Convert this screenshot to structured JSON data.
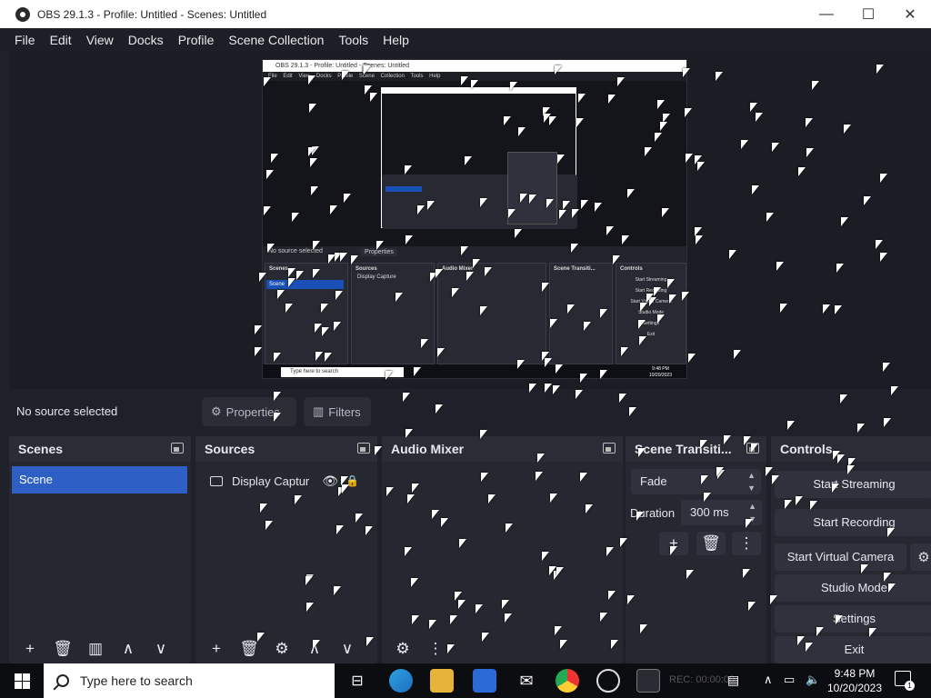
{
  "window": {
    "title": "OBS 29.1.3 - Profile: Untitled - Scenes: Untitled",
    "min": "—",
    "max": "☐",
    "close": "✕"
  },
  "menu": [
    "File",
    "Edit",
    "View",
    "Docks",
    "Profile",
    "Scene Collection",
    "Tools",
    "Help"
  ],
  "preview": {
    "title": "OBS 29.1.3 - Profile: Untitled - Scenes: Untitled",
    "menu": "File Edit View Docks Profile Scene Collection Tools Help",
    "no_source": "No source selected",
    "properties": "Properties",
    "scenes": "Scenes",
    "sources": "Sources",
    "audio_mixer": "Audio Mixer",
    "scene_trans": "Scene Transiti...",
    "controls": "Controls",
    "scene": "Scene",
    "display_capture": "Display Capture",
    "start_streaming": "Start Streaming",
    "start_recording": "Start Recording",
    "start_virtual": "Start Virtual Camera",
    "studio_mode": "Studio Mode",
    "settings": "Settings",
    "exit": "Exit",
    "taskbar_search": "Type here to search",
    "time": "9:48 PM",
    "date": "10/20/2023"
  },
  "source_bar": {
    "no_source": "No source selected",
    "properties": "Properties",
    "filters": "Filters"
  },
  "docks": {
    "scenes": {
      "title": "Scenes",
      "items": [
        "Scene"
      ]
    },
    "sources": {
      "title": "Sources",
      "items": [
        "Display Captur"
      ]
    },
    "audio_mixer": {
      "title": "Audio Mixer"
    },
    "transitions": {
      "title": "Scene Transiti...",
      "selected": "Fade",
      "duration_label": "Duration",
      "duration_value": "300 ms"
    },
    "controls": {
      "title": "Controls",
      "start_streaming": "Start Streaming",
      "start_recording": "Start Recording",
      "start_virtual": "Start Virtual Camera",
      "studio_mode": "Studio Mode",
      "settings": "Settings",
      "exit": "Exit"
    }
  },
  "toolbar_icons": {
    "add": "+",
    "remove": "🗑",
    "filter": "▥",
    "up": "∧",
    "down": "∨",
    "gear": "⚙",
    "more": "⋮"
  },
  "taskbar": {
    "search_placeholder": "Type here to search",
    "rec": "REC: 00:00:00",
    "time": "9:48 PM",
    "date": "10/20/2023",
    "notif_count": "1"
  },
  "colors": {
    "accent": "#2d5fc4",
    "panel": "#262831",
    "background": "#1f212a"
  }
}
